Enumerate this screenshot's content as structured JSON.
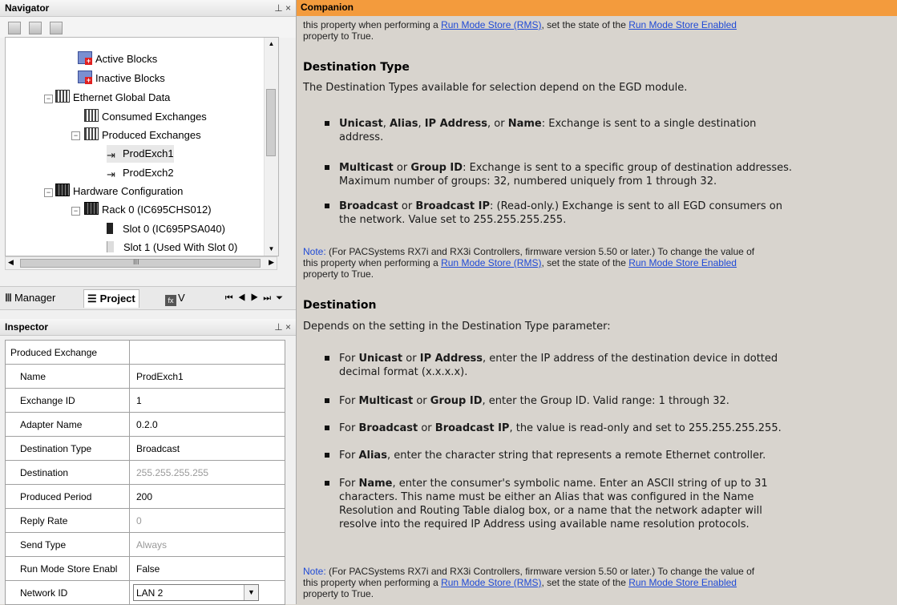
{
  "navigator": {
    "title": "Navigator",
    "pin_glyph": "⊥ ×",
    "tree": {
      "active_blocks": "Active Blocks",
      "inactive_blocks": "Inactive Blocks",
      "ethernet_global_data": "Ethernet Global Data",
      "consumed_exchanges": "Consumed Exchanges",
      "produced_exchanges": "Produced Exchanges",
      "prodexch1": "ProdExch1",
      "prodexch2": "ProdExch2",
      "hardware_configuration": "Hardware Configuration",
      "rack0": "Rack 0 (IC695CHS012)",
      "slot0": "Slot 0 (IC695PSA040)",
      "slot1": "Slot 1 (Used With Slot 0)"
    },
    "hscroll_glyph": "III",
    "tabs": {
      "manager": "Manager",
      "project": "Project",
      "v": "V"
    }
  },
  "inspector": {
    "title": "Inspector",
    "pin_glyph": "⊥ ×",
    "group": "Produced Exchange",
    "rows": [
      {
        "name": "Name",
        "value": "ProdExch1"
      },
      {
        "name": "Exchange ID",
        "value": "1"
      },
      {
        "name": "Adapter Name",
        "value": "0.2.0"
      },
      {
        "name": "Destination Type",
        "value": "Broadcast"
      },
      {
        "name": "Destination",
        "value": "255.255.255.255"
      },
      {
        "name": "Produced Period",
        "value": "200"
      },
      {
        "name": "Reply Rate",
        "value": "0"
      },
      {
        "name": "Send Type",
        "value": "Always"
      },
      {
        "name": "Run Mode Store Enabl",
        "value": "False"
      },
      {
        "name": "Network ID",
        "value": "LAN 2"
      }
    ]
  },
  "companion": {
    "title": "Companion",
    "top_note": {
      "text1": "this property when performing a ",
      "link1": "Run Mode Store (RMS)",
      "text2": ", set the state of the ",
      "link2": "Run Mode Store Enabled",
      "text3": "property to True."
    },
    "dest_type": {
      "heading": "Destination Type",
      "intro": "The Destination Types available for selection depend on the EGD module.",
      "b1_t1": "Unicast",
      "b1_t2": ", ",
      "b1_t3": "Alias",
      "b1_t4": ", ",
      "b1_t5": "IP Address",
      "b1_t6": ", or ",
      "b1_t7": "Name",
      "b1_t8": ": Exchange is sent to a single destination",
      "b1_l2": "address.",
      "b2_t1": "Multicast",
      "b2_t2": " or ",
      "b2_t3": "Group ID",
      "b2_t4": ": Exchange is sent to a specific group of destination addresses.",
      "b2_l2": "Maximum number of groups: 32, numbered uniquely from 1 through 32.",
      "b3_t1": "Broadcast",
      "b3_t2": " or ",
      "b3_t3": "Broadcast IP",
      "b3_t4": ": (Read-only.) Exchange is sent to all EGD consumers on",
      "b3_l2": "the network. Value set to 255.255.255.255."
    },
    "note": {
      "label": "Note:",
      "line1": " (For PACSystems RX7i and RX3i Controllers, firmware version 5.50 or later.) To change the value of",
      "l2_t1": "this property when performing a ",
      "l2_link1": "Run Mode Store (RMS)",
      "l2_t2": ", set the state of the ",
      "l2_link2": "Run Mode Store Enabled",
      "line3": "property to True."
    },
    "destination": {
      "heading": "Destination",
      "intro": "Depends on the setting in the Destination Type parameter:",
      "b1_t1": "For ",
      "b1_t2": "Unicast",
      "b1_t3": " or ",
      "b1_t4": "IP Address",
      "b1_t5": ", enter the IP address of the destination device in dotted",
      "b1_l2": "decimal format (x.x.x.x).",
      "b2_t1": "For ",
      "b2_t2": "Multicast",
      "b2_t3": " or ",
      "b2_t4": "Group ID",
      "b2_t5": ", enter the Group ID. Valid range: 1 through 32.",
      "b3_t1": "For ",
      "b3_t2": "Broadcast",
      "b3_t3": " or ",
      "b3_t4": "Broadcast IP",
      "b3_t5": ", the value is read-only and set to 255.255.255.255.",
      "b4_t1": "For ",
      "b4_t2": "Alias",
      "b4_t3": ", enter the character string that represents a remote Ethernet controller.",
      "b5_t1": "For ",
      "b5_t2": "Name",
      "b5_t3": ", enter the consumer's symbolic name. Enter an ASCII string of up to 31",
      "b5_l2": "characters. This name must be either an Alias that was configured in the Name",
      "b5_l3": "Resolution and Routing Table dialog box, or a name that the network adapter will",
      "b5_l4": "resolve into the required IP Address using available name resolution protocols."
    }
  },
  "icons": [
    "pin-icon",
    "close-icon",
    "block-icon",
    "egd-icon",
    "exchange-icon",
    "rack-icon",
    "slot-icon",
    "dropdown-arrow-icon"
  ]
}
